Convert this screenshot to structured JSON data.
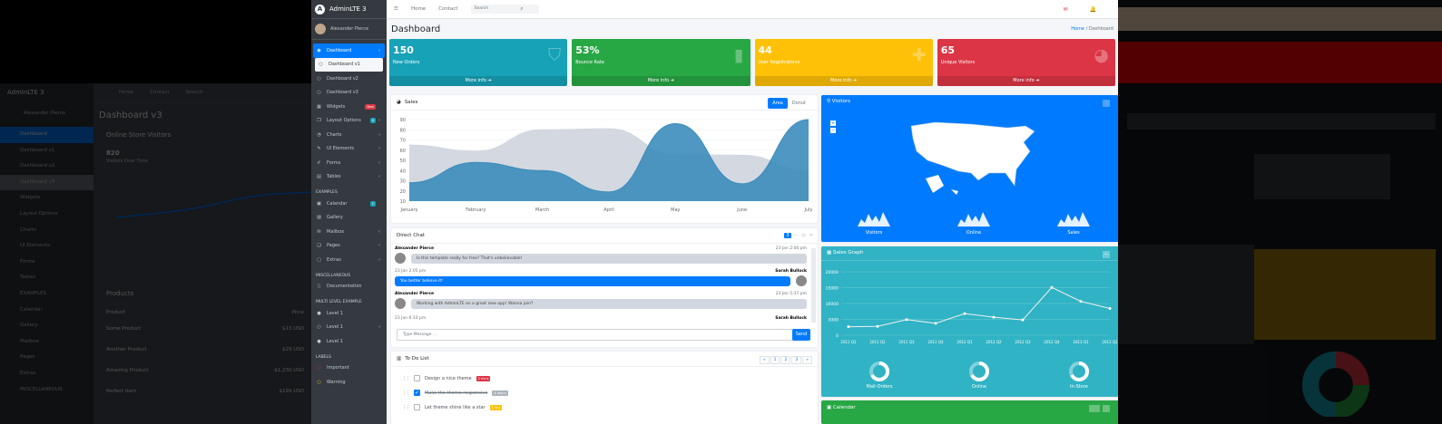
{
  "brand": "AdminLTE 3",
  "user": "Alexander Pierce",
  "topnav": {
    "home": "Home",
    "contact": "Contact",
    "search_placeholder": "Search"
  },
  "page": {
    "title": "Dashboard",
    "bc_home": "Home",
    "bc_sep": "/",
    "bc_cur": "Dashboard"
  },
  "nav": [
    {
      "label": "Dashboard",
      "icon": "◉",
      "state": "active",
      "arrow": "‹"
    },
    {
      "label": "Dashboard v1",
      "icon": "○",
      "state": "sub-active"
    },
    {
      "label": "Dashboard v2",
      "icon": "○"
    },
    {
      "label": "Dashboard v3",
      "icon": "○"
    },
    {
      "label": "Widgets",
      "icon": "▦",
      "badge": "New",
      "badge_color": "#dc3545"
    },
    {
      "label": "Layout Options",
      "icon": "❐",
      "badge": "6",
      "badge_color": "#17a2b8",
      "arrow": "‹"
    },
    {
      "label": "Charts",
      "icon": "◔",
      "arrow": "‹"
    },
    {
      "label": "UI Elements",
      "icon": "✎",
      "arrow": "‹"
    },
    {
      "label": "Forms",
      "icon": "✐",
      "arrow": "‹"
    },
    {
      "label": "Tables",
      "icon": "▤",
      "arrow": "‹"
    },
    {
      "header": "EXAMPLES"
    },
    {
      "label": "Calendar",
      "icon": "▣",
      "badge": "2",
      "badge_color": "#17a2b8"
    },
    {
      "label": "Gallery",
      "icon": "▨"
    },
    {
      "label": "Mailbox",
      "icon": "✉",
      "arrow": "‹"
    },
    {
      "label": "Pages",
      "icon": "❏",
      "arrow": "‹"
    },
    {
      "label": "Extras",
      "icon": "▢",
      "arrow": "‹"
    },
    {
      "header": "MISCELLANEOUS"
    },
    {
      "label": "Documentation",
      "icon": "▯"
    },
    {
      "header": "MULTI LEVEL EXAMPLE"
    },
    {
      "label": "Level 1",
      "icon": "●"
    },
    {
      "label": "Level 1",
      "icon": "○",
      "arrow": "‹"
    },
    {
      "label": "Level 1",
      "icon": "●"
    },
    {
      "header": "LABELS"
    },
    {
      "label": "Important",
      "icon": "○",
      "icon_color": "#dc3545"
    },
    {
      "label": "Warning",
      "icon": "○",
      "icon_color": "#ffc107"
    }
  ],
  "stats": [
    {
      "num": "150",
      "label": "New Orders",
      "icon": "⛉",
      "color": "#17a2b8",
      "more": "More info ➔"
    },
    {
      "num": "53%",
      "label": "Bounce Rate",
      "icon": "▮",
      "color": "#28a745",
      "more": "More info ➔"
    },
    {
      "num": "44",
      "label": "User Registrations",
      "icon": "✚",
      "color": "#ffc107",
      "more": "More info ➔"
    },
    {
      "num": "65",
      "label": "Unique Visitors",
      "icon": "◕",
      "color": "#dc3545",
      "more": "More info ➔"
    }
  ],
  "sales": {
    "title": "Sales",
    "tab_area": "Area",
    "tab_donut": "Donut"
  },
  "chart_data": {
    "type": "area",
    "categories": [
      "January",
      "February",
      "March",
      "April",
      "May",
      "June",
      "July"
    ],
    "ylim": [
      10,
      90
    ],
    "yticks": [
      "90",
      "80",
      "70",
      "60",
      "50",
      "40",
      "30",
      "20",
      "10"
    ],
    "series": [
      {
        "values": [
          28,
          48,
          40,
          19,
          86,
          27,
          90
        ],
        "color": "#3c8dbc"
      },
      {
        "values": [
          65,
          59,
          80,
          81,
          56,
          55,
          40
        ],
        "color": "#d2d6de"
      }
    ]
  },
  "chat": {
    "title": "Direct Chat",
    "badge": "3",
    "placeholder": "Type Message ...",
    "send": "Send",
    "msgs": [
      {
        "name": "Alexander Pierce",
        "time": "23 Jan 2:00 pm",
        "text": "Is this template really for free? That's unbelievable!",
        "side": "left"
      },
      {
        "name": "Sarah Bullock",
        "time": "23 Jan 2:05 pm",
        "text": "You better believe it!",
        "side": "right"
      },
      {
        "name": "Alexander Pierce",
        "time": "23 Jan 5:37 pm",
        "text": "Working with AdminLTE on a great new app! Wanna join?",
        "side": "left"
      },
      {
        "name": "Sarah Bullock",
        "time": "23 Jan 6:10 pm",
        "text": "",
        "side": "right"
      }
    ]
  },
  "todo": {
    "title": "To Do List",
    "pages": [
      "«",
      "1",
      "2",
      "3",
      "»"
    ],
    "items": [
      {
        "text": "Design a nice theme",
        "badge": "2 mins",
        "badge_color": "#dc3545",
        "done": false
      },
      {
        "text": "Make the theme responsive",
        "badge": "4 hours",
        "badge_color": "#adb5bd",
        "done": true
      },
      {
        "text": "Let theme shine like a star",
        "badge": "1 day",
        "badge_color": "#ffc107",
        "done": false
      }
    ]
  },
  "visitors": {
    "title": "Visitors",
    "spark": [
      "Visitors",
      "Online",
      "Sales"
    ]
  },
  "salesgraph": {
    "title": "Sales Graph",
    "yticks": [
      "20000",
      "15000",
      "10000",
      "5000",
      "0"
    ],
    "xlabels": [
      "2011 Q1",
      "2011 Q2",
      "2011 Q3",
      "2011 Q4",
      "2012 Q1",
      "2012 Q2",
      "2012 Q3",
      "2012 Q4",
      "2013 Q1",
      "2013 Q2"
    ],
    "values": [
      2666,
      2778,
      4912,
      3767,
      6810,
      5670,
      4820,
      15073,
      10687,
      8432
    ],
    "knobs": [
      "Mail-Orders",
      "Online",
      "In-Store"
    ]
  },
  "calendar": {
    "title": "Calendar"
  },
  "bg": {
    "v3_title": "Dashboard v3",
    "v3_sub": "Online Store Visitors",
    "v3_big": "820",
    "v3_sub2": "Visitors Over Time",
    "products": "Products",
    "prod_col": "Product",
    "price_col": "Price",
    "prods": [
      [
        "Some Product",
        "$13 USD"
      ],
      [
        "Another Product",
        "$29 USD"
      ],
      [
        "Amazing Product",
        "$1,230 USD"
      ],
      [
        "Perfect Item",
        "$199 USD"
      ]
    ],
    "side": [
      "Dashboard",
      "Dashboard v1",
      "Dashboard v2",
      "Dashboard v3",
      "Widgets",
      "Layout Options",
      "Charts",
      "UI Elements",
      "Forms",
      "Tables",
      "EXAMPLES",
      "Calendar",
      "Gallery",
      "Mailbox",
      "Pages",
      "Extras",
      "MISCELLANEOUS"
    ]
  }
}
